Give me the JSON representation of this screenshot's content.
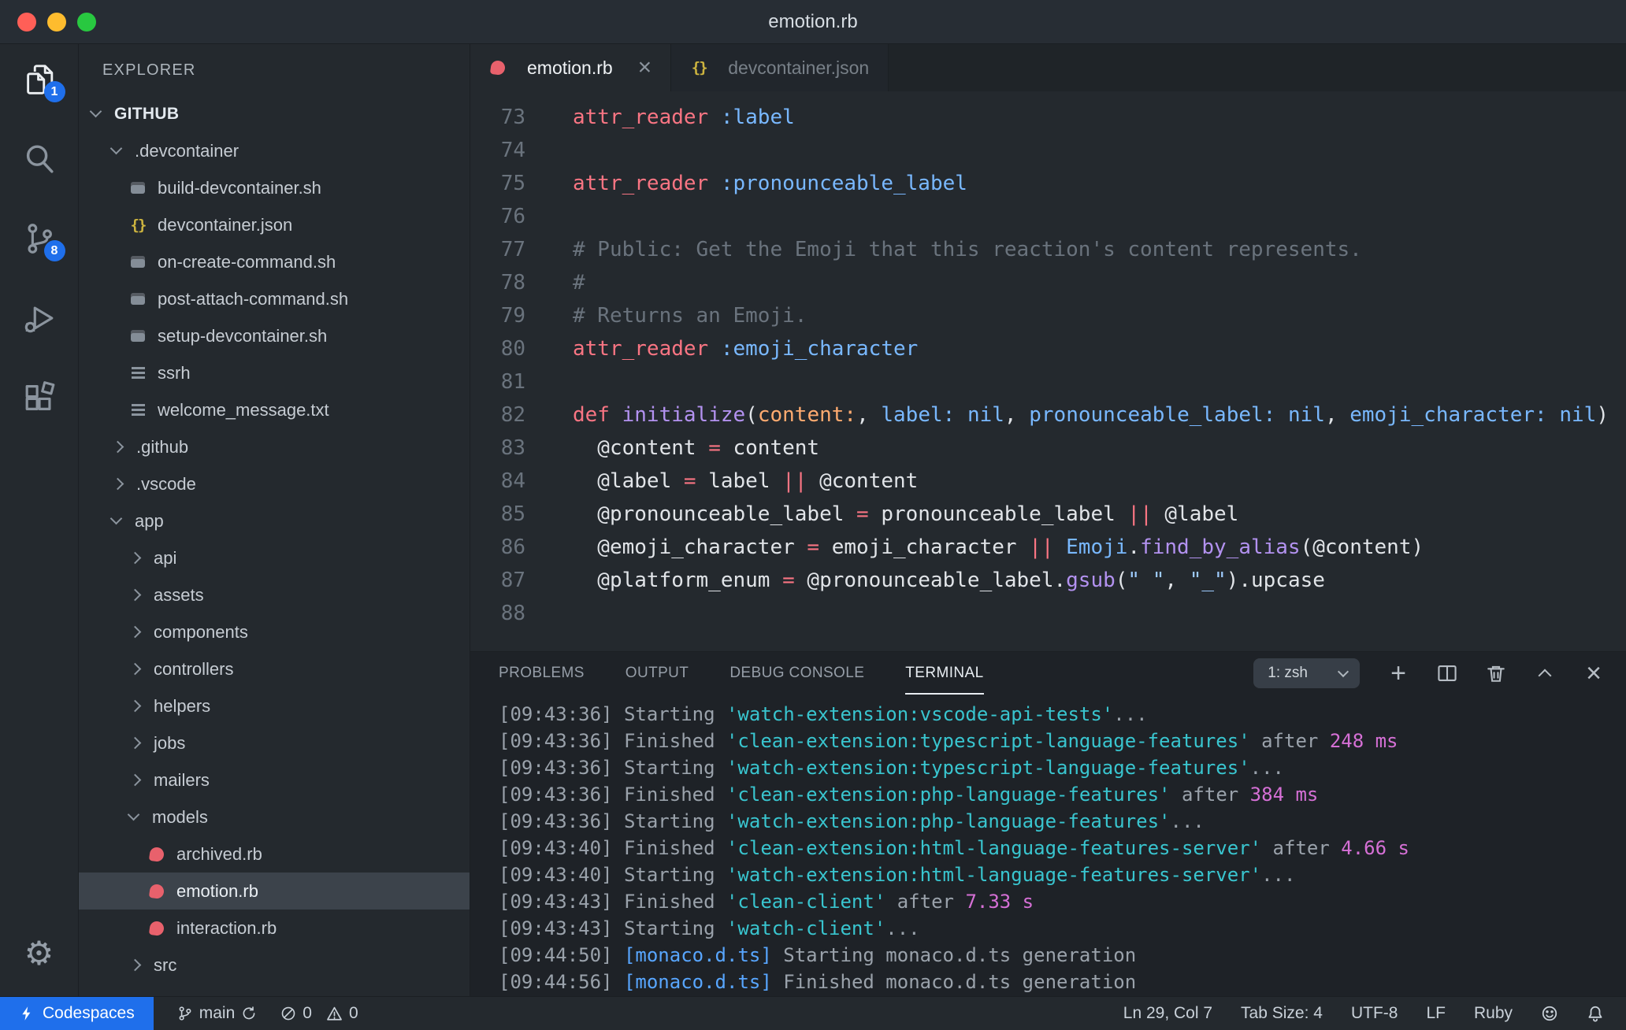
{
  "titlebar": {
    "title": "emotion.rb"
  },
  "activity_bar": {
    "explorer_badge": "1",
    "scm_badge": "8"
  },
  "glyphs": {
    "close": "×",
    "plus": "+"
  },
  "sidebar": {
    "header": "EXPLORER",
    "tree": [
      {
        "label": "GITHUB",
        "type": "root",
        "level": 0,
        "expanded": true
      },
      {
        "label": ".devcontainer",
        "type": "folder",
        "level": 1,
        "expanded": true
      },
      {
        "label": "build-devcontainer.sh",
        "type": "file",
        "icon": "sh",
        "level": 2
      },
      {
        "label": "devcontainer.json",
        "type": "file",
        "icon": "json",
        "level": 2
      },
      {
        "label": "on-create-command.sh",
        "type": "file",
        "icon": "sh",
        "level": 2
      },
      {
        "label": "post-attach-command.sh",
        "type": "file",
        "icon": "sh",
        "level": 2
      },
      {
        "label": "setup-devcontainer.sh",
        "type": "file",
        "icon": "sh",
        "level": 2
      },
      {
        "label": "ssrh",
        "type": "file",
        "icon": "list",
        "level": 2
      },
      {
        "label": "welcome_message.txt",
        "type": "file",
        "icon": "list",
        "level": 2
      },
      {
        "label": ".github",
        "type": "folder",
        "level": 1,
        "expanded": false
      },
      {
        "label": ".vscode",
        "type": "folder",
        "level": 1,
        "expanded": false
      },
      {
        "label": "app",
        "type": "folder",
        "level": 1,
        "expanded": true
      },
      {
        "label": "api",
        "type": "folder",
        "level": 2,
        "expanded": false
      },
      {
        "label": "assets",
        "type": "folder",
        "level": 2,
        "expanded": false
      },
      {
        "label": "components",
        "type": "folder",
        "level": 2,
        "expanded": false
      },
      {
        "label": "controllers",
        "type": "folder",
        "level": 2,
        "expanded": false
      },
      {
        "label": "helpers",
        "type": "folder",
        "level": 2,
        "expanded": false
      },
      {
        "label": "jobs",
        "type": "folder",
        "level": 2,
        "expanded": false
      },
      {
        "label": "mailers",
        "type": "folder",
        "level": 2,
        "expanded": false
      },
      {
        "label": "models",
        "type": "folder",
        "level": 2,
        "expanded": true
      },
      {
        "label": "archived.rb",
        "type": "file",
        "icon": "ruby",
        "level": 3
      },
      {
        "label": "emotion.rb",
        "type": "file",
        "icon": "ruby",
        "level": 3,
        "selected": true
      },
      {
        "label": "interaction.rb",
        "type": "file",
        "icon": "ruby",
        "level": 3
      },
      {
        "label": "src",
        "type": "folder",
        "level": 2,
        "expanded": false
      }
    ]
  },
  "tabs": [
    {
      "label": "emotion.rb",
      "icon": "ruby",
      "active": true
    },
    {
      "label": "devcontainer.json",
      "icon": "json",
      "active": false
    }
  ],
  "editor": {
    "lines": [
      {
        "n": "73",
        "seg": [
          [
            "k",
            "attr_reader"
          ],
          [
            "f",
            " "
          ],
          [
            "b",
            ":label"
          ]
        ]
      },
      {
        "n": "74",
        "seg": []
      },
      {
        "n": "75",
        "seg": [
          [
            "k",
            "attr_reader"
          ],
          [
            "f",
            " "
          ],
          [
            "b",
            ":pronounceable_label"
          ]
        ]
      },
      {
        "n": "76",
        "seg": []
      },
      {
        "n": "77",
        "seg": [
          [
            "c",
            "# Public: Get the Emoji that this reaction's content represents."
          ]
        ]
      },
      {
        "n": "78",
        "seg": [
          [
            "c",
            "#"
          ]
        ]
      },
      {
        "n": "79",
        "seg": [
          [
            "c",
            "# Returns an Emoji."
          ]
        ]
      },
      {
        "n": "80",
        "seg": [
          [
            "k",
            "attr_reader"
          ],
          [
            "f",
            " "
          ],
          [
            "b",
            ":emoji_character"
          ]
        ]
      },
      {
        "n": "81",
        "seg": []
      },
      {
        "n": "82",
        "seg": [
          [
            "k",
            "def"
          ],
          [
            "f",
            " "
          ],
          [
            "pu",
            "initialize"
          ],
          [
            "f",
            "("
          ],
          [
            "o",
            "content:"
          ],
          [
            "f",
            ", "
          ],
          [
            "b",
            "label:"
          ],
          [
            "f",
            " "
          ],
          [
            "b",
            "nil"
          ],
          [
            "f",
            ", "
          ],
          [
            "b",
            "pronounceable_label:"
          ],
          [
            "f",
            " "
          ],
          [
            "b",
            "nil"
          ],
          [
            "f",
            ", "
          ],
          [
            "b",
            "emoji_character:"
          ],
          [
            "f",
            " "
          ],
          [
            "b",
            "nil"
          ],
          [
            "f",
            ")"
          ]
        ]
      },
      {
        "n": "83",
        "seg": [
          [
            "f",
            "  @content "
          ],
          [
            "k",
            "="
          ],
          [
            "f",
            " content"
          ]
        ]
      },
      {
        "n": "84",
        "seg": [
          [
            "f",
            "  @label "
          ],
          [
            "k",
            "="
          ],
          [
            "f",
            " label "
          ],
          [
            "k",
            "||"
          ],
          [
            "f",
            " @content"
          ]
        ]
      },
      {
        "n": "85",
        "seg": [
          [
            "f",
            "  @pronounceable_label "
          ],
          [
            "k",
            "="
          ],
          [
            "f",
            " pronounceable_label "
          ],
          [
            "k",
            "||"
          ],
          [
            "f",
            " @label"
          ]
        ]
      },
      {
        "n": "86",
        "seg": [
          [
            "f",
            "  @emoji_character "
          ],
          [
            "k",
            "="
          ],
          [
            "f",
            " emoji_character "
          ],
          [
            "k",
            "||"
          ],
          [
            "f",
            " "
          ],
          [
            "b",
            "Emoji"
          ],
          [
            "f",
            "."
          ],
          [
            "pu",
            "find_by_alias"
          ],
          [
            "f",
            "(@content)"
          ]
        ]
      },
      {
        "n": "87",
        "seg": [
          [
            "f",
            "  @platform_enum "
          ],
          [
            "k",
            "="
          ],
          [
            "f",
            " @pronounceable_label."
          ],
          [
            "pu",
            "gsub"
          ],
          [
            "f",
            "("
          ],
          [
            "s",
            "\" \""
          ],
          [
            "f",
            ", "
          ],
          [
            "s",
            "\"_\""
          ],
          [
            "f",
            ").upcase"
          ]
        ]
      },
      {
        "n": "88",
        "seg": []
      }
    ]
  },
  "panel": {
    "tabs": [
      {
        "label": "PROBLEMS",
        "active": false
      },
      {
        "label": "OUTPUT",
        "active": false
      },
      {
        "label": "DEBUG CONSOLE",
        "active": false
      },
      {
        "label": "TERMINAL",
        "active": true
      }
    ],
    "shell_select": "1: zsh",
    "terminal": [
      {
        "seg": [
          [
            "d",
            "[09:43:36] Starting "
          ],
          [
            "cy",
            "'watch-extension:vscode-api-tests'"
          ],
          [
            "d",
            "..."
          ]
        ]
      },
      {
        "seg": [
          [
            "d",
            "[09:43:36] Finished "
          ],
          [
            "cy",
            "'clean-extension:typescript-language-features'"
          ],
          [
            "d",
            " after "
          ],
          [
            "m",
            "248 ms"
          ]
        ]
      },
      {
        "seg": [
          [
            "d",
            "[09:43:36] Starting "
          ],
          [
            "cy",
            "'watch-extension:typescript-language-features'"
          ],
          [
            "d",
            "..."
          ]
        ]
      },
      {
        "seg": [
          [
            "d",
            "[09:43:36] Finished "
          ],
          [
            "cy",
            "'clean-extension:php-language-features'"
          ],
          [
            "d",
            " after "
          ],
          [
            "m",
            "384 ms"
          ]
        ]
      },
      {
        "seg": [
          [
            "d",
            "[09:43:36] Starting "
          ],
          [
            "cy",
            "'watch-extension:php-language-features'"
          ],
          [
            "d",
            "..."
          ]
        ]
      },
      {
        "seg": [
          [
            "d",
            "[09:43:40] Finished "
          ],
          [
            "cy",
            "'clean-extension:html-language-features-server'"
          ],
          [
            "d",
            " after "
          ],
          [
            "m",
            "4.66 s"
          ]
        ]
      },
      {
        "seg": [
          [
            "d",
            "[09:43:40] Starting "
          ],
          [
            "cy",
            "'watch-extension:html-language-features-server'"
          ],
          [
            "d",
            "..."
          ]
        ]
      },
      {
        "seg": [
          [
            "d",
            "[09:43:43] Finished "
          ],
          [
            "cy",
            "'clean-client'"
          ],
          [
            "d",
            " after "
          ],
          [
            "m",
            "7.33 s"
          ]
        ]
      },
      {
        "seg": [
          [
            "d",
            "[09:43:43] Starting "
          ],
          [
            "cy",
            "'watch-client'"
          ],
          [
            "d",
            "..."
          ]
        ]
      },
      {
        "seg": [
          [
            "d",
            "[09:44:50] "
          ],
          [
            "bl",
            "[monaco.d.ts]"
          ],
          [
            "d",
            " Starting monaco.d.ts generation"
          ]
        ]
      },
      {
        "seg": [
          [
            "d",
            "[09:44:56] "
          ],
          [
            "bl",
            "[monaco.d.ts]"
          ],
          [
            "d",
            " Finished monaco.d.ts generation"
          ]
        ]
      }
    ]
  },
  "statusbar": {
    "codespaces": "Codespaces",
    "branch": "main",
    "errors": "0",
    "warnings": "0",
    "line_col": "Ln 29, Col 7",
    "tab_size": "Tab Size: 4",
    "encoding": "UTF-8",
    "eol": "LF",
    "language": "Ruby"
  }
}
